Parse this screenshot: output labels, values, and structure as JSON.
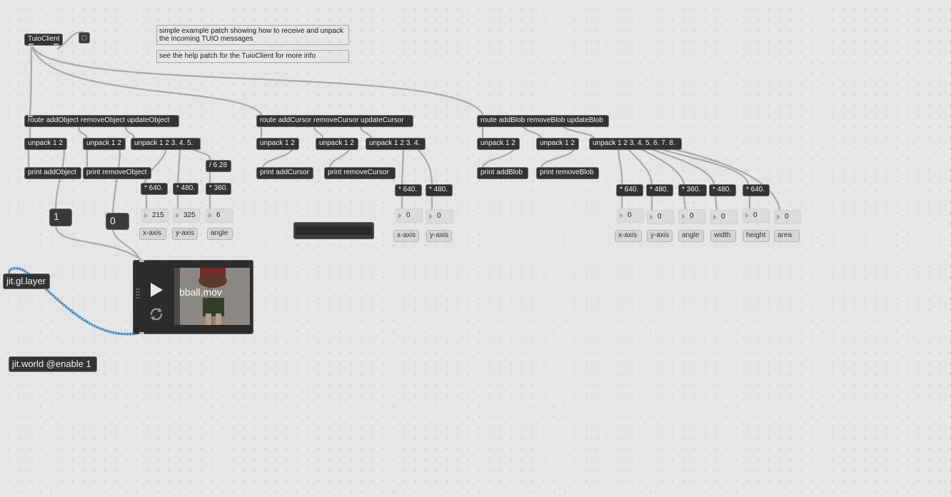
{
  "patch": {
    "tuio_client": "TuioClient",
    "comments": {
      "intro": "simple example patch showing how to receive and unpack the incoming TUIO messages",
      "help": "see the help patch for the TuioClient for more info"
    },
    "objects_section": {
      "route": "route addObject removeObject updateObject",
      "unpack_add": "unpack 1 2",
      "unpack_remove": "unpack 1 2",
      "unpack_update": "unpack 1 2 3. 4. 5.",
      "print_add": "print addObject",
      "print_remove": "print removeObject",
      "div_angle": "/ 6.28",
      "mul_x": "* 640.",
      "mul_y": "* 480.",
      "mul_angle": "* 360.",
      "num_x": "215",
      "num_y": "325",
      "num_angle": "6",
      "lbl_x": "x-axis",
      "lbl_y": "y-axis",
      "lbl_angle": "angle"
    },
    "cursor_section": {
      "route": "route addCursor removeCursor updateCursor",
      "unpack_add": "unpack 1 2",
      "unpack_remove": "unpack 1 2",
      "unpack_update": "unpack 1 2 3. 4.",
      "print_add": "print addCursor",
      "print_remove": "print removeCursor",
      "mul_x": "* 640.",
      "mul_y": "* 480.",
      "num_x": "0",
      "num_y": "0",
      "lbl_x": "x-axis",
      "lbl_y": "y-axis"
    },
    "blob_section": {
      "route": "route addBlob removeBlob updateBlob",
      "unpack_add": "unpack 1 2",
      "unpack_remove": "unpack 1 2",
      "unpack_update": "unpack 1 2 3. 4. 5. 6. 7. 8.",
      "print_add": "print addBlob",
      "print_remove": "print removeBlob",
      "mul_x": "* 640.",
      "mul_y": "* 480.",
      "mul_angle": "* 360.",
      "mul_width": "* 480.",
      "mul_height": "* 640.",
      "num_x": "0",
      "num_y": "0",
      "num_angle": "0",
      "num_width": "0",
      "num_height": "0",
      "num_area": "0",
      "lbl_x": "x-axis",
      "lbl_y": "y-axis",
      "lbl_angle": "angle",
      "lbl_width": "width",
      "lbl_height": "height",
      "lbl_area": "area"
    },
    "number_one": "1",
    "number_zero": "0",
    "jit_gl_layer": "jit.gl.layer",
    "jit_world": "jit.world @enable 1",
    "player": {
      "movie_name": "bball.mov",
      "icons": [
        "play-icon",
        "loop-icon",
        "drag-handle-icon"
      ]
    }
  },
  "colors": {
    "canvas": "#e6e6e6",
    "object_bg": "#333333",
    "patch_cord": "#a9a9a9",
    "signal_cord_a": "#2f79b6",
    "signal_cord_b": "#ffffff"
  }
}
